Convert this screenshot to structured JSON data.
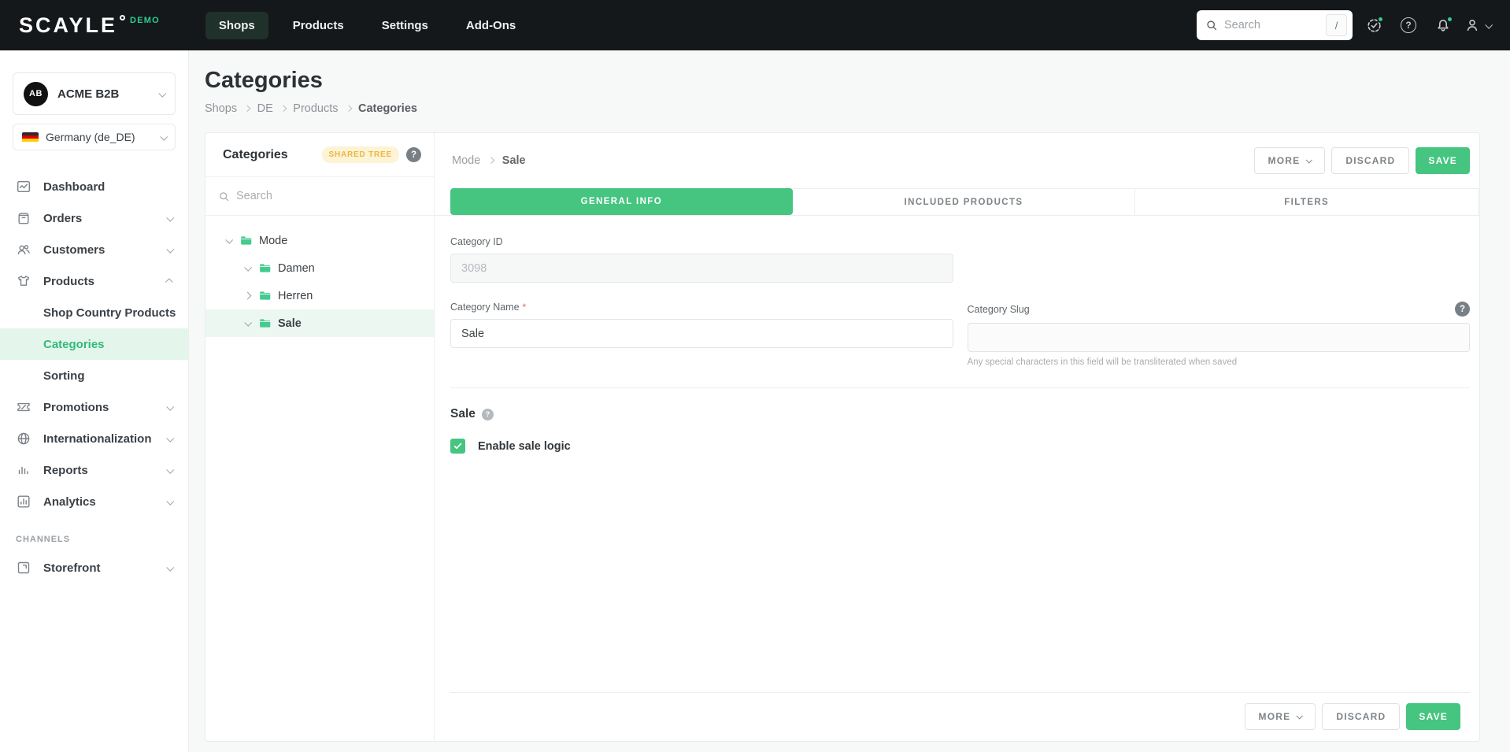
{
  "colors": {
    "accent": "#45c57f",
    "badge_text": "#efb540",
    "active_nav_bg": "#20302a"
  },
  "topbar": {
    "logo": "SCAYLE",
    "logo_badge": "DEMO",
    "nav": [
      {
        "label": "Shops",
        "active": true
      },
      {
        "label": "Products",
        "active": false
      },
      {
        "label": "Settings",
        "active": false
      },
      {
        "label": "Add-Ons",
        "active": false
      }
    ],
    "search": {
      "placeholder": "Search",
      "shortcut": "/"
    },
    "help_glyph": "?"
  },
  "sidebar": {
    "shop": {
      "initials": "AB",
      "name": "ACME B2B"
    },
    "country": {
      "label": "Germany (de_DE)"
    },
    "menu": [
      {
        "label": "Dashboard"
      },
      {
        "label": "Orders"
      },
      {
        "label": "Customers"
      },
      {
        "label": "Products"
      },
      {
        "label": "Promotions"
      },
      {
        "label": "Internationalization"
      },
      {
        "label": "Reports"
      },
      {
        "label": "Analytics"
      }
    ],
    "products_children": [
      {
        "label": "Shop Country Products",
        "active": false
      },
      {
        "label": "Categories",
        "active": true
      },
      {
        "label": "Sorting",
        "active": false
      }
    ],
    "channels_label": "CHANNELS",
    "channels": [
      {
        "label": "Storefront"
      }
    ]
  },
  "page": {
    "title": "Categories",
    "breadcrumb": [
      {
        "label": "Shops"
      },
      {
        "label": "DE"
      },
      {
        "label": "Products"
      },
      {
        "label": "Categories"
      }
    ]
  },
  "tree": {
    "title": "Categories",
    "badge": "SHARED TREE",
    "help_glyph": "?",
    "search_placeholder": "Search",
    "nodes": [
      {
        "label": "Mode",
        "level": 0,
        "expanded": true,
        "selected": false
      },
      {
        "label": "Damen",
        "level": 1,
        "expanded": true,
        "selected": false
      },
      {
        "label": "Herren",
        "level": 1,
        "expanded": false,
        "selected": false
      },
      {
        "label": "Sale",
        "level": 1,
        "expanded": true,
        "selected": true
      }
    ]
  },
  "detail": {
    "breadcrumb": [
      {
        "label": "Mode"
      },
      {
        "label": "Sale"
      }
    ],
    "actions": {
      "more": "MORE",
      "discard": "DISCARD",
      "save": "SAVE"
    },
    "tabs": [
      {
        "label": "GENERAL INFO",
        "active": true
      },
      {
        "label": "INCLUDED PRODUCTS",
        "active": false
      },
      {
        "label": "FILTERS",
        "active": false
      }
    ],
    "form": {
      "category_id": {
        "label": "Category ID",
        "value": "3098",
        "disabled": true
      },
      "category_name": {
        "label": "Category Name",
        "required_mark": "*",
        "value": "Sale"
      },
      "category_slug": {
        "label": "Category Slug",
        "value": "",
        "help_glyph": "?",
        "helper": "Any special characters in this field will be transliterated when saved"
      }
    },
    "sale": {
      "title": "Sale",
      "help_glyph": "?",
      "checkbox_label": "Enable sale logic",
      "checked": true
    }
  },
  "footer": {
    "more": "MORE",
    "discard": "DISCARD",
    "save": "SAVE"
  }
}
